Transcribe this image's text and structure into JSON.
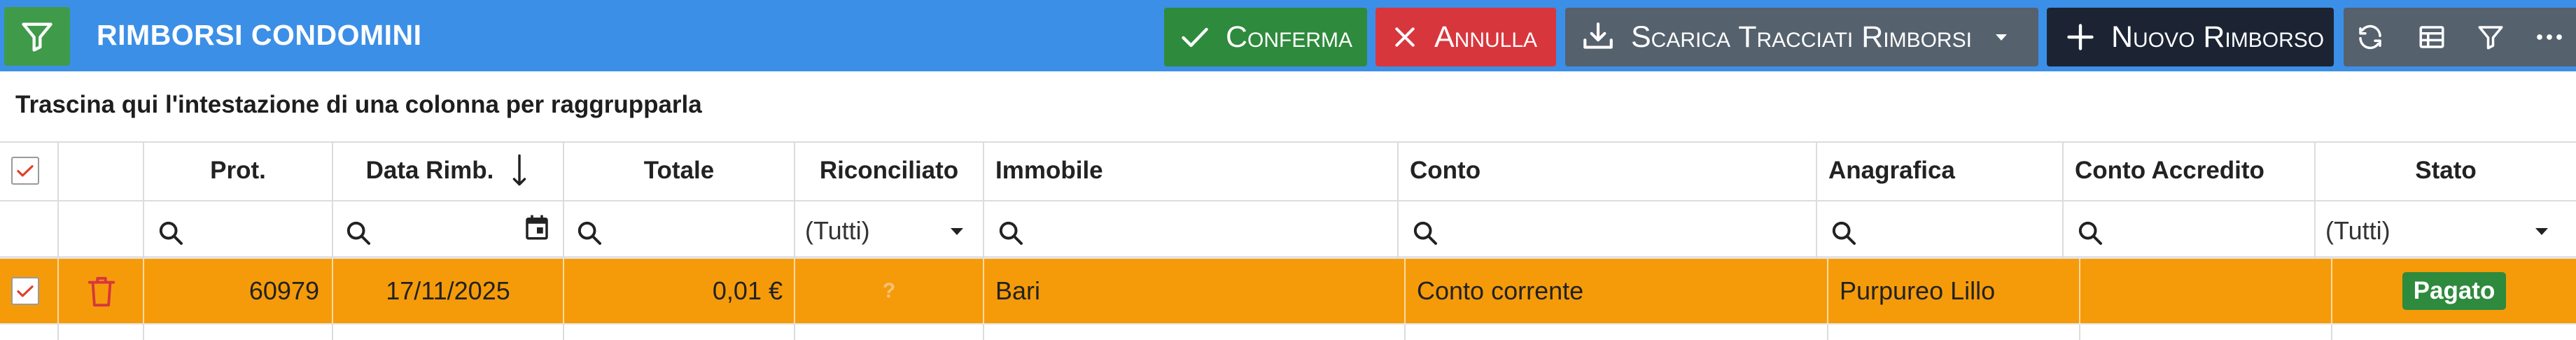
{
  "toolbar": {
    "title": "RIMBORSI CONDOMINI",
    "confirm_label": "Conferma",
    "cancel_label": "Annulla",
    "download_label": "Scarica Tracciati Rimborsi",
    "new_label": "Nuovo Rimborso",
    "icons": [
      "filter-icon",
      "check-icon",
      "close-icon",
      "download-icon",
      "plus-icon",
      "refresh-icon",
      "columns-icon",
      "filter-icon",
      "more-icon"
    ]
  },
  "group_panel": {
    "text": "Trascina qui l'intestazione di una colonna per raggrupparla"
  },
  "columns": {
    "prot": "Prot.",
    "data_rimb": "Data Rimb.",
    "totale": "Totale",
    "riconciliato": "Riconciliato",
    "immobile": "Immobile",
    "conto": "Conto",
    "anagrafica": "Anagrafica",
    "conto_accredito": "Conto Accredito",
    "stato": "Stato"
  },
  "filters": {
    "riconciliato": "(Tutti)",
    "stato": "(Tutti)"
  },
  "rows": [
    {
      "selected": true,
      "prot": "60979",
      "data_rimb": "17/11/2025",
      "totale": "0,01 €",
      "riconciliato": "?",
      "immobile": "Bari",
      "conto": "Conto corrente",
      "anagrafica": "Purpureo Lillo",
      "conto_accredito": "",
      "stato": "Pagato"
    }
  ],
  "colors": {
    "toolbar": "#3c8fe6",
    "confirm": "#2e8a3c",
    "cancel": "#d8363d",
    "download": "#55616d",
    "new": "#1c2434",
    "row_selected": "#f59b0a",
    "status_paid": "#2e8a3c",
    "delete_icon": "#d8363d"
  }
}
